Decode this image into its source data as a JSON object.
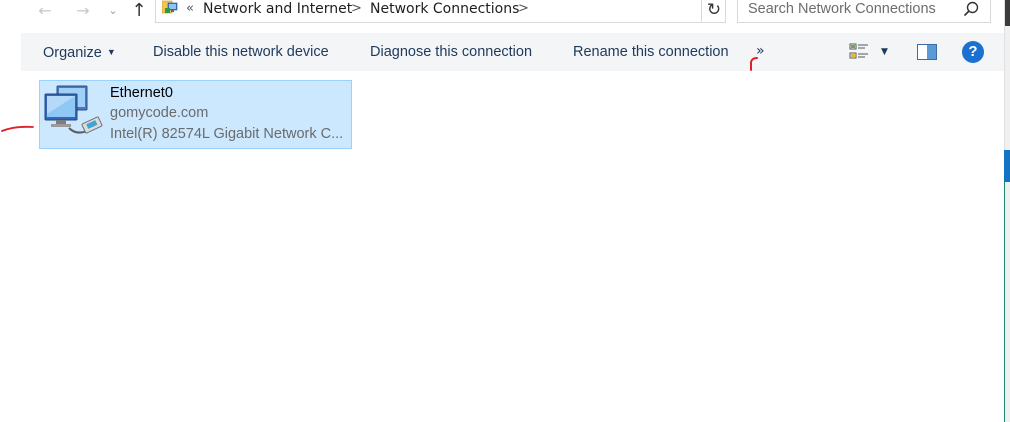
{
  "address_bar": {
    "overflow_chevron": "«",
    "crumbs": [
      "Network and Internet",
      "Network Connections"
    ],
    "separator": ">"
  },
  "search": {
    "placeholder": "Search Network Connections"
  },
  "toolbar": {
    "organize_label": "Organize",
    "disable_label": "Disable this network device",
    "diagnose_label": "Diagnose this connection",
    "rename_label": "Rename this connection",
    "more_label": "»",
    "help_label": "?"
  },
  "connection": {
    "name": "Ethernet0",
    "domain": "gomycode.com",
    "device": "Intel(R) 82574L Gigabit Network C..."
  },
  "colors": {
    "selection_bg": "#cce8ff",
    "selection_border": "#99d1ff",
    "command_bar_bg": "#f4f5f7",
    "link_text": "#1e395b",
    "help_blue": "#1b71cf",
    "annotation_red": "#e0202a"
  },
  "icons": [
    "back-arrow-icon",
    "forward-arrow-icon",
    "up-arrow-icon",
    "network-connections-icon",
    "refresh-icon",
    "search-icon",
    "view-options-icon",
    "preview-pane-icon",
    "help-icon",
    "ethernet-adapter-icon"
  ]
}
